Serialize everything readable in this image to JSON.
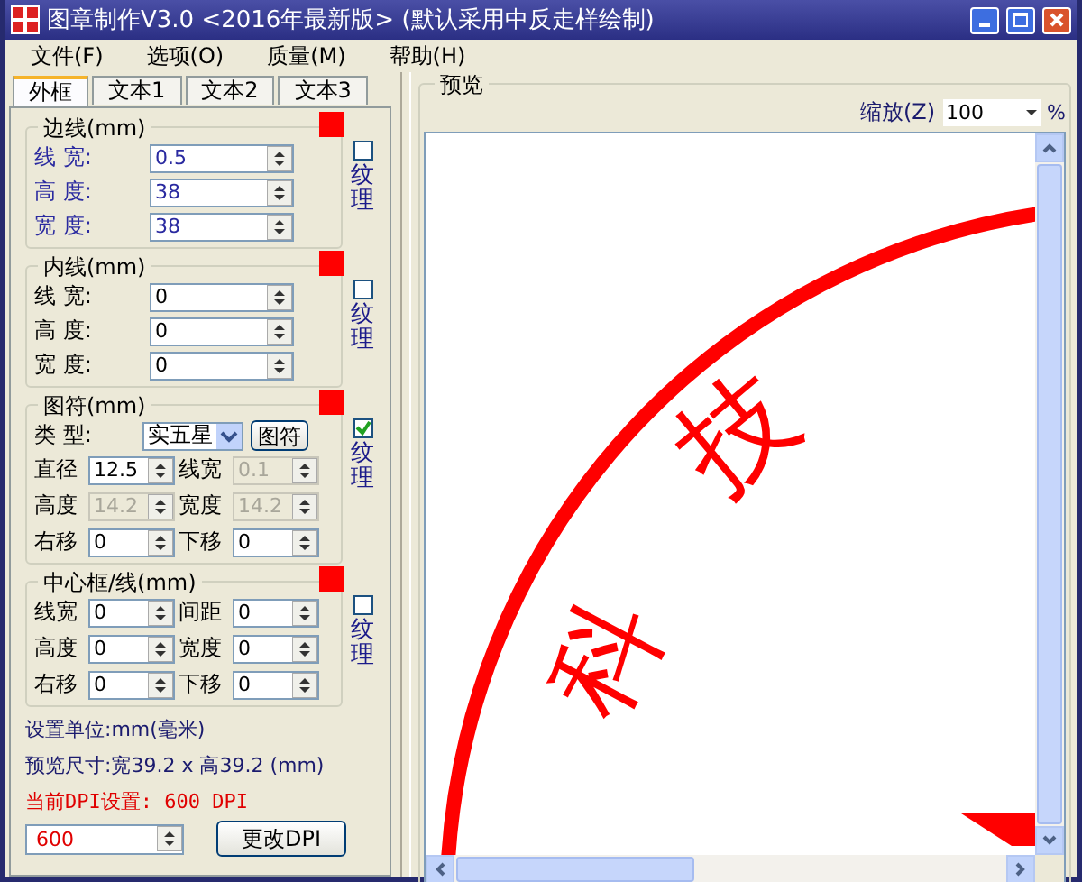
{
  "window": {
    "title": "图章制作V3.0 <2016年最新版> (默认采用中反走样绘制)"
  },
  "menu": [
    {
      "label": "文件(F)"
    },
    {
      "label": "选项(O)"
    },
    {
      "label": "质量(M)"
    },
    {
      "label": "帮助(H)"
    }
  ],
  "tabs": [
    {
      "label": "外框",
      "selected": true
    },
    {
      "label": "文本1",
      "selected": false
    },
    {
      "label": "文本2",
      "selected": false
    },
    {
      "label": "文本3",
      "selected": false
    }
  ],
  "groups": [
    {
      "title": "边线(mm)",
      "kind": "list",
      "emphasized": true,
      "color": "#ff0000",
      "texture": {
        "label": "纹理",
        "checked": false
      },
      "fields": [
        {
          "label": "线 宽:",
          "value": "0.5",
          "disabled": false
        },
        {
          "label": "高 度:",
          "value": "38",
          "disabled": false
        },
        {
          "label": "宽 度:",
          "value": "38",
          "disabled": false
        }
      ]
    },
    {
      "title": "内线(mm)",
      "kind": "list",
      "emphasized": false,
      "color": "#ff0000",
      "texture": {
        "label": "纹理",
        "checked": false
      },
      "fields": [
        {
          "label": "线 宽:",
          "value": "0",
          "disabled": false
        },
        {
          "label": "高 度:",
          "value": "0",
          "disabled": false
        },
        {
          "label": "宽 度:",
          "value": "0",
          "disabled": false
        }
      ]
    },
    {
      "title": "图符(mm)",
      "kind": "grid",
      "emphasized": false,
      "color": "#ff0000",
      "texture": {
        "label": "纹理",
        "checked": true
      },
      "type_row": {
        "label": "类 型:",
        "value": "实五星",
        "button": "图符"
      },
      "fields": [
        {
          "label": "直径",
          "value": "12.5",
          "disabled": false
        },
        {
          "label": "线宽",
          "value": "0.1",
          "disabled": true
        },
        {
          "label": "高度",
          "value": "14.2",
          "disabled": true
        },
        {
          "label": "宽度",
          "value": "14.2",
          "disabled": true
        },
        {
          "label": "右移",
          "value": "0",
          "disabled": false
        },
        {
          "label": "下移",
          "value": "0",
          "disabled": false
        }
      ]
    },
    {
      "title": "中心框/线(mm)",
      "kind": "grid",
      "emphasized": false,
      "color": "#ff0000",
      "texture": {
        "label": "纹理",
        "checked": false
      },
      "fields": [
        {
          "label": "线宽",
          "value": "0",
          "disabled": false
        },
        {
          "label": "间距",
          "value": "0",
          "disabled": false
        },
        {
          "label": "高度",
          "value": "0",
          "disabled": false
        },
        {
          "label": "宽度",
          "value": "0",
          "disabled": false
        },
        {
          "label": "右移",
          "value": "0",
          "disabled": false
        },
        {
          "label": "下移",
          "value": "0",
          "disabled": false
        }
      ]
    }
  ],
  "info": [
    {
      "text": "设置单位:mm(毫米)",
      "kind": "note"
    },
    {
      "text": "预览尺寸:宽39.2 x 高39.2 (mm)",
      "kind": "note"
    },
    {
      "text": "当前DPI设置: 600 DPI",
      "kind": "alert"
    }
  ],
  "dpi": {
    "value": "600",
    "button": "更改DPI"
  },
  "preview": {
    "title": "预览",
    "zoom_label": "缩放(Z)",
    "zoom_value": "100",
    "zoom_unit": "%",
    "stamp_text": [
      "科",
      "技"
    ]
  }
}
